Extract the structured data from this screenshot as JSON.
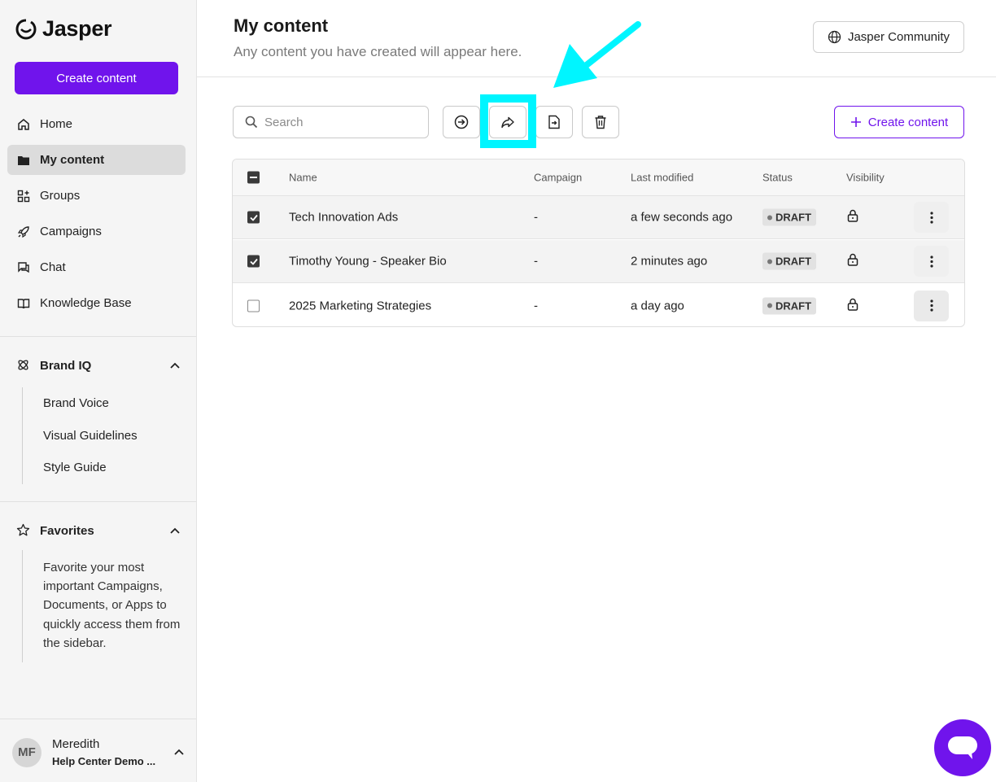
{
  "brand": {
    "name": "Jasper",
    "accent": "#7014ec",
    "highlight": "#00f5ff"
  },
  "sidebar": {
    "create_label": "Create content",
    "nav": [
      {
        "label": "Home",
        "icon": "home-icon"
      },
      {
        "label": "My content",
        "icon": "folder-icon",
        "active": true
      },
      {
        "label": "Groups",
        "icon": "groups-icon"
      },
      {
        "label": "Campaigns",
        "icon": "rocket-icon"
      },
      {
        "label": "Chat",
        "icon": "chat-icon"
      },
      {
        "label": "Knowledge Base",
        "icon": "book-icon"
      }
    ],
    "brand_iq": {
      "label": "Brand IQ",
      "items": [
        "Brand Voice",
        "Visual Guidelines",
        "Style Guide"
      ]
    },
    "favorites": {
      "label": "Favorites",
      "empty_text": "Favorite your most important Campaigns, Documents, or Apps to quickly access them from the sidebar."
    },
    "user": {
      "initials": "MF",
      "name": "Meredith",
      "org": "Help Center Demo ..."
    }
  },
  "header": {
    "title": "My content",
    "subtitle": "Any content you have created will appear here.",
    "community_label": "Jasper Community"
  },
  "toolbar": {
    "search_placeholder": "Search",
    "create_label": "Create content"
  },
  "table": {
    "columns": [
      "Name",
      "Campaign",
      "Last modified",
      "Status",
      "Visibility"
    ],
    "rows": [
      {
        "name": "Tech Innovation Ads",
        "campaign": "-",
        "modified": "a few seconds ago",
        "status": "DRAFT",
        "selected": true
      },
      {
        "name": "Timothy Young - Speaker Bio",
        "campaign": "-",
        "modified": "2 minutes ago",
        "status": "DRAFT",
        "selected": true
      },
      {
        "name": "2025 Marketing Strategies",
        "campaign": "-",
        "modified": "a day ago",
        "status": "DRAFT",
        "selected": false
      }
    ]
  }
}
